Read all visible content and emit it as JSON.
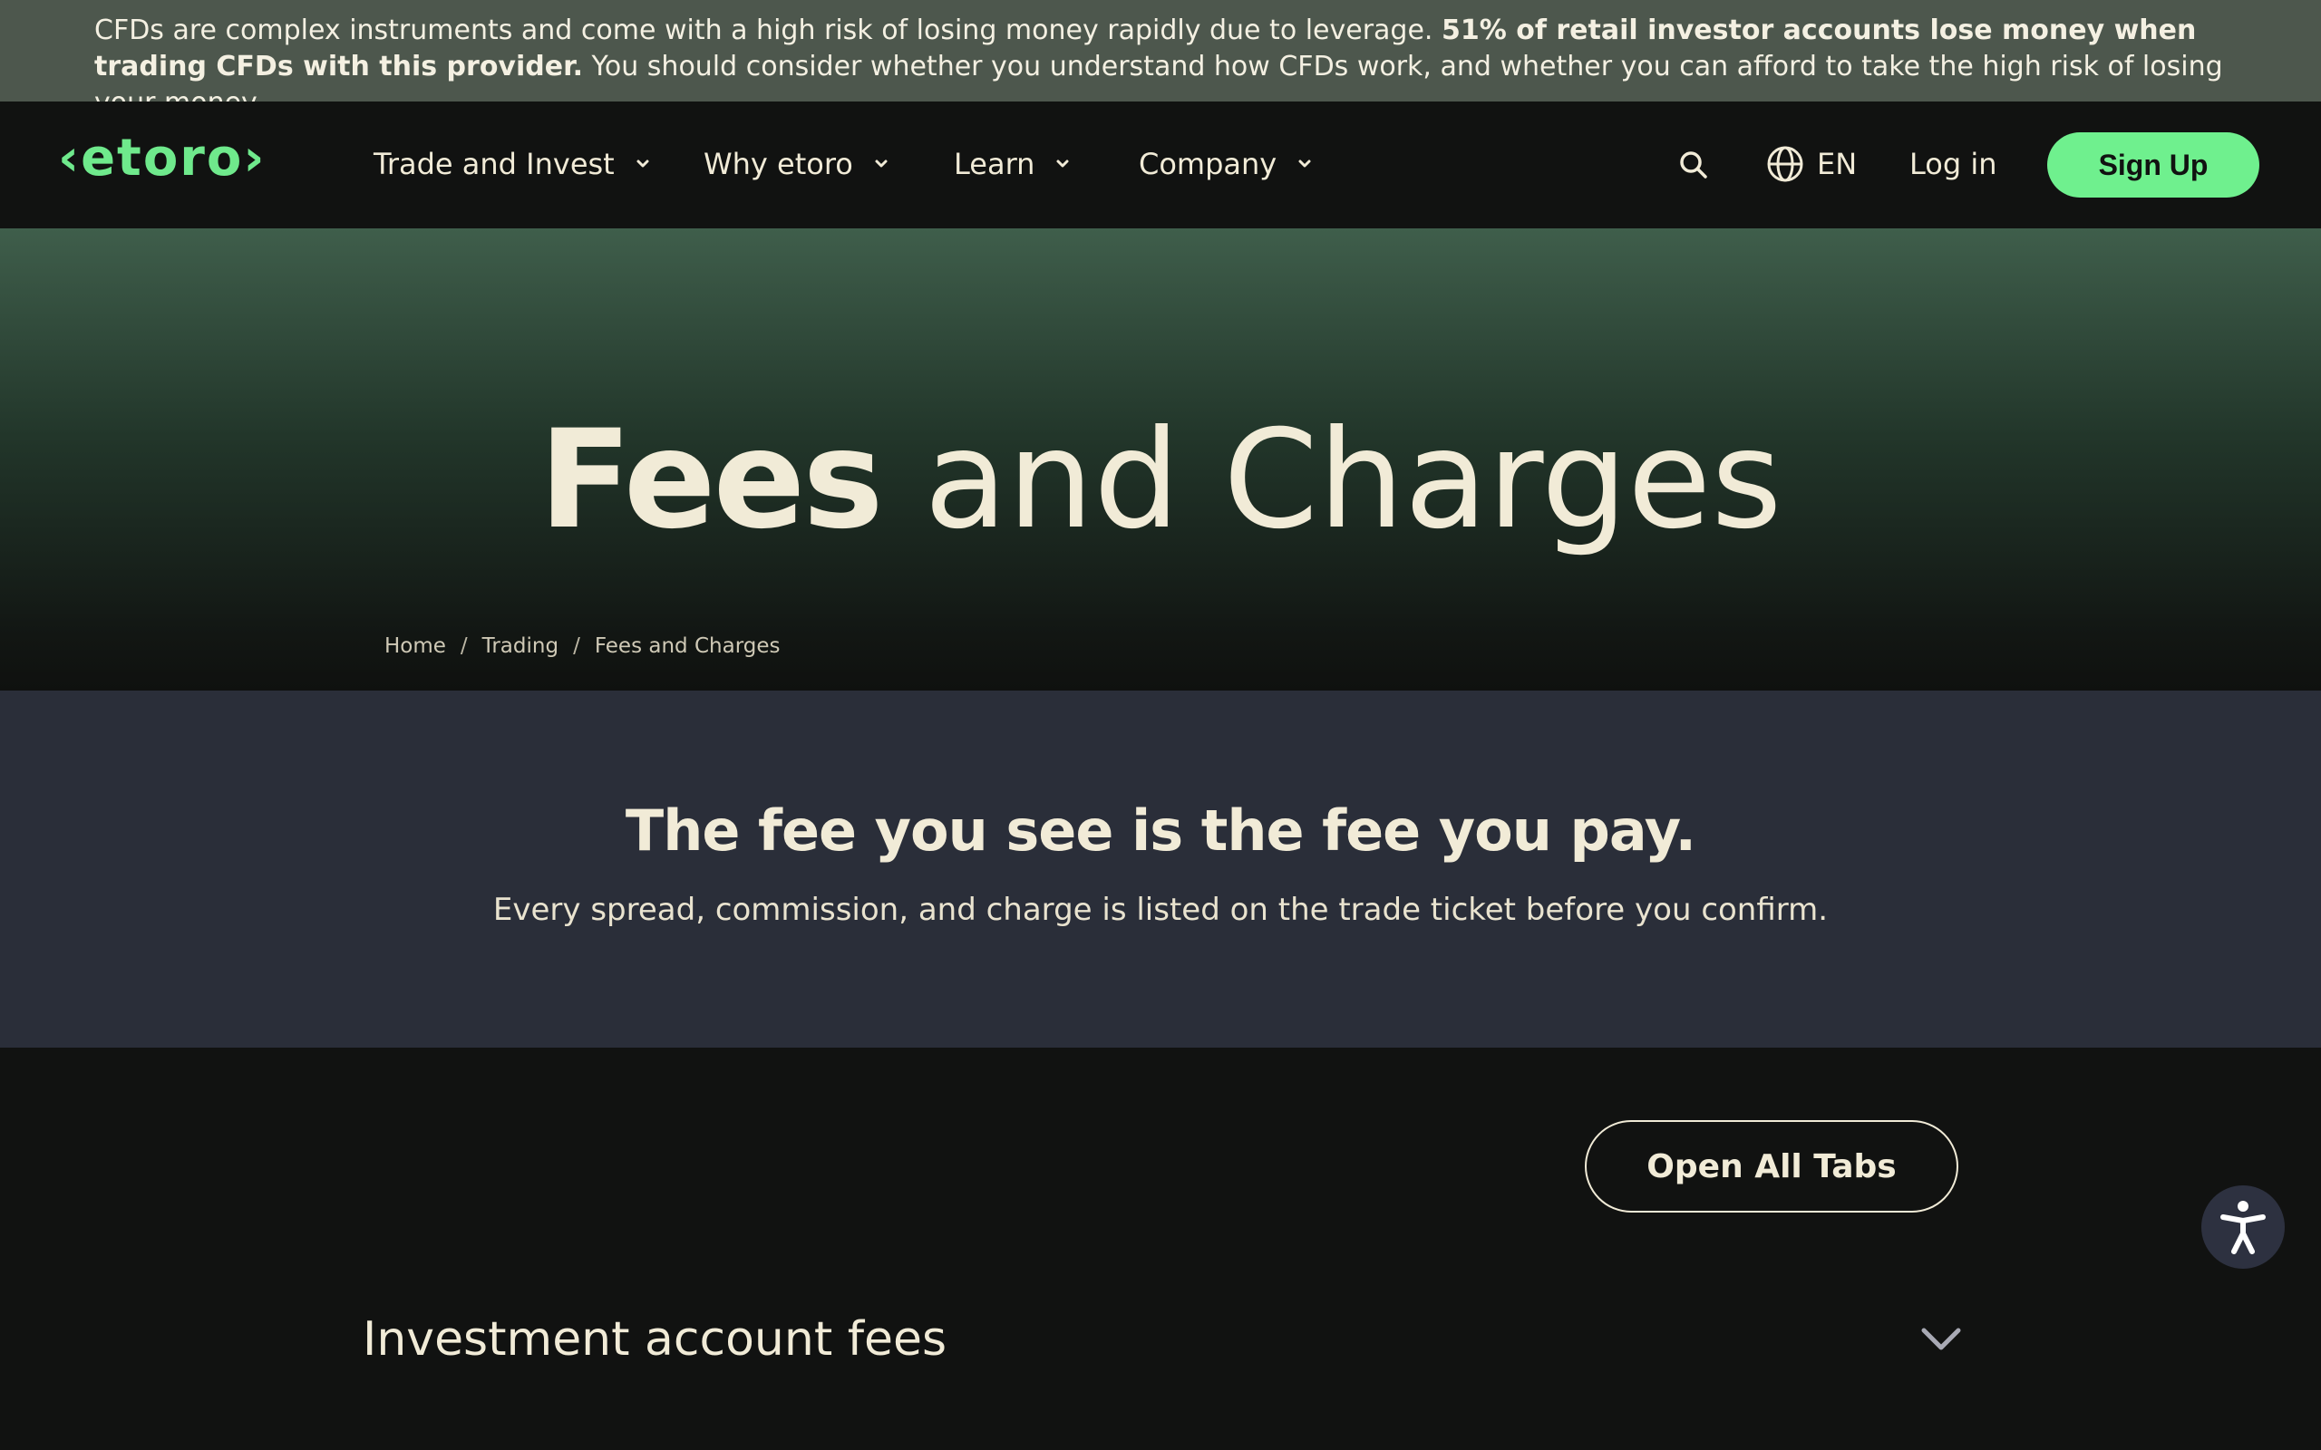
{
  "risk_warning": {
    "text_part1": "CFDs are complex instruments and come with a high risk of losing money rapidly due to leverage. ",
    "text_bold": "51% of retail investor accounts lose money when trading CFDs with this provider.",
    "text_part2": " You should consider whether you understand how CFDs work, and whether you can afford to take the high risk of losing your money."
  },
  "nav": {
    "logo": "‹etoro›",
    "menu": [
      {
        "label": "Trade and Invest"
      },
      {
        "label": "Why etoro"
      },
      {
        "label": "Learn"
      },
      {
        "label": "Company"
      }
    ],
    "language": "EN",
    "login": "Log in",
    "signup": "Sign Up"
  },
  "hero": {
    "title_bold": "Fees",
    "title_light": " and Charges",
    "breadcrumbs": [
      {
        "label": "Home"
      },
      {
        "label": "Trading"
      },
      {
        "label": "Fees and Charges"
      }
    ]
  },
  "statement": {
    "heading": "The fee you see is the fee you pay.",
    "subtext": "Every spread, commission, and charge is listed on the trade ticket before you confirm."
  },
  "content": {
    "open_all": "Open All Tabs",
    "accordion_items": [
      {
        "label": "Investment account fees"
      }
    ]
  },
  "colors": {
    "accent_green": "#6ff08e",
    "banner_bg": "#4d574d",
    "statement_bg": "#2a2e39",
    "page_bg": "#111211",
    "text_cream": "#f1ebd7"
  }
}
